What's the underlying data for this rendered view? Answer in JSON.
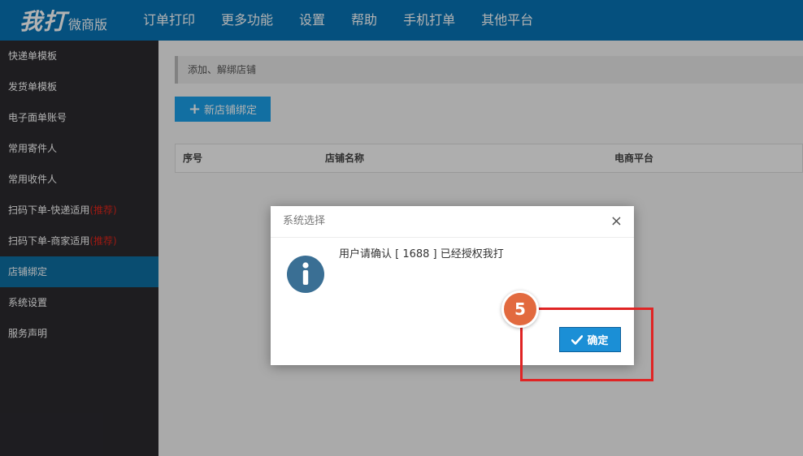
{
  "header": {
    "logo_main": "我打",
    "logo_sub": "微商版",
    "nav": [
      "订单打印",
      "更多功能",
      "设置",
      "帮助",
      "手机打单",
      "其他平台"
    ]
  },
  "sidebar": {
    "items": [
      {
        "label": "快递单模板",
        "tag": ""
      },
      {
        "label": "发货单模板",
        "tag": ""
      },
      {
        "label": "电子面单账号",
        "tag": ""
      },
      {
        "label": "常用寄件人",
        "tag": ""
      },
      {
        "label": "常用收件人",
        "tag": ""
      },
      {
        "label": "扫码下单-快递适用",
        "tag": "(推荐)"
      },
      {
        "label": "扫码下单-商家适用",
        "tag": "(推荐)"
      },
      {
        "label": "店铺绑定",
        "tag": ""
      },
      {
        "label": "系统设置",
        "tag": ""
      },
      {
        "label": "服务声明",
        "tag": ""
      }
    ],
    "active_index": 7
  },
  "main": {
    "breadcrumb": "添加、解绑店铺",
    "add_button": "新店铺绑定",
    "table_headers": [
      "序号",
      "店铺名称",
      "电商平台"
    ]
  },
  "dialog": {
    "title": "系统选择",
    "message": "用户请确认 [ 1688 ] 已经授权我打",
    "confirm_label": "确定",
    "close_symbol": "×"
  },
  "annotation": {
    "step_number": "5"
  },
  "colors": {
    "topbar": "#0873b5",
    "sidebar": "#2b2a2f",
    "sidebar_active": "#0d6fa3",
    "primary_button": "#1aa0e8",
    "highlight": "#e02424",
    "step_badge": "#e26a3f"
  }
}
